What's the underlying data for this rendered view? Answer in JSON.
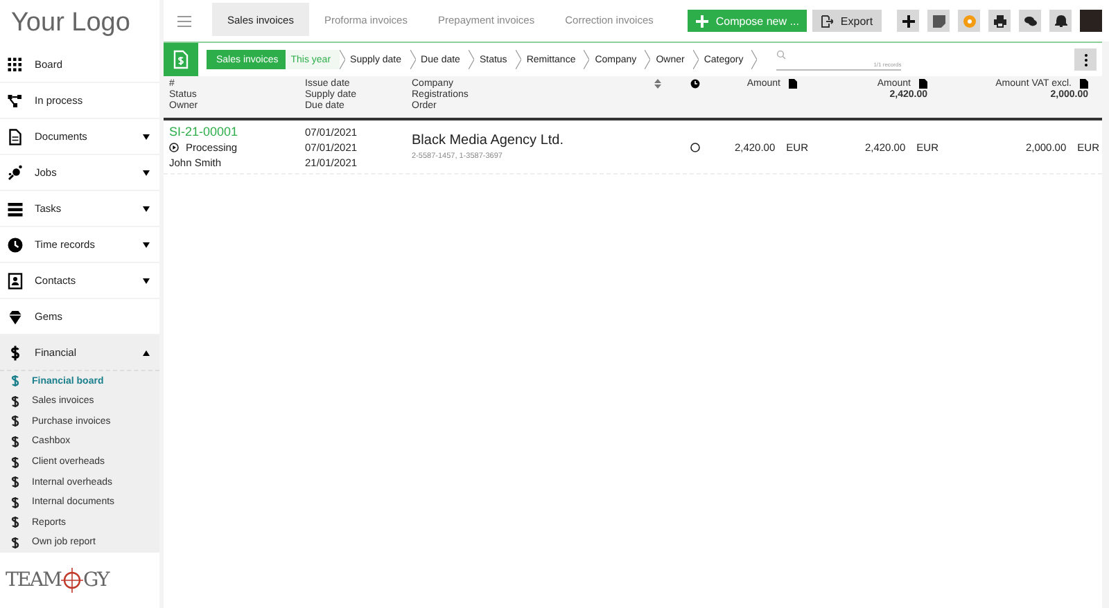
{
  "logo": {
    "text": "Your Logo"
  },
  "sidebar": {
    "items": [
      {
        "label": "Board",
        "kind": "link",
        "expanded": false
      },
      {
        "label": "In process",
        "kind": "link",
        "expanded": false
      },
      {
        "label": "Documents",
        "kind": "menu",
        "expanded": false
      },
      {
        "label": "Jobs",
        "kind": "menu",
        "expanded": false
      },
      {
        "label": "Tasks",
        "kind": "menu",
        "expanded": false
      },
      {
        "label": "Time records",
        "kind": "menu",
        "expanded": false
      },
      {
        "label": "Contacts",
        "kind": "menu",
        "expanded": false
      },
      {
        "label": "Gems",
        "kind": "link",
        "expanded": false
      },
      {
        "label": "Financial",
        "kind": "menu",
        "expanded": true,
        "children": [
          {
            "label": "Financial board",
            "selected": true
          },
          {
            "label": "Sales invoices",
            "selected": false
          },
          {
            "label": "Purchase invoices",
            "selected": false
          },
          {
            "label": "Cashbox",
            "selected": false
          },
          {
            "label": "Client overheads",
            "selected": false
          },
          {
            "label": "Internal overheads",
            "selected": false
          },
          {
            "label": "Internal documents",
            "selected": false
          },
          {
            "label": "Reports",
            "selected": false
          },
          {
            "label": "Own job report",
            "selected": false
          }
        ]
      }
    ]
  },
  "brand": {
    "left": "TEAM",
    "right": "GY"
  },
  "tabs": [
    {
      "label": "Sales invoices",
      "selected": true
    },
    {
      "label": "Proforma invoices",
      "selected": false
    },
    {
      "label": "Prepayment invoices",
      "selected": false
    },
    {
      "label": "Correction invoices",
      "selected": false
    }
  ],
  "actions": [
    {
      "label": "Compose new ...",
      "kind": "primary"
    },
    {
      "label": "Export",
      "kind": "secondary"
    }
  ],
  "filters": [
    {
      "label": "Sales invoices",
      "kind": "primary"
    },
    {
      "label": "This year",
      "kind": "active"
    },
    {
      "label": "Supply date",
      "kind": "plain"
    },
    {
      "label": "Due date",
      "kind": "plain"
    },
    {
      "label": "Status",
      "kind": "plain"
    },
    {
      "label": "Remittance",
      "kind": "plain"
    },
    {
      "label": "Company",
      "kind": "plain"
    },
    {
      "label": "Owner",
      "kind": "plain"
    },
    {
      "label": "Category",
      "kind": "plain"
    }
  ],
  "search": {
    "records": "1/1 records"
  },
  "table": {
    "columns": [
      {
        "lines": [
          "#",
          "Status",
          "Owner"
        ]
      },
      {
        "lines": [
          "Issue date",
          "Supply date",
          "Due date"
        ]
      },
      {
        "lines": [
          "Company",
          "Registrations",
          "Order"
        ]
      }
    ],
    "amount_columns": [
      {
        "label": "Amount"
      },
      {
        "label": "Amount",
        "total": "2,420.00"
      },
      {
        "label": "Amount VAT excl.",
        "total": "2,000.00"
      }
    ],
    "rows": [
      {
        "number": "SI-21-00001",
        "status": "Processing",
        "owner": "John Smith",
        "dates": [
          "07/01/2021",
          "07/01/2021",
          "21/01/2021"
        ],
        "company": "Black Media Agency Ltd.",
        "registrations": "2-5587-1457, 1-3587-3697",
        "amounts": [
          {
            "value": "2,420.00",
            "currency": "EUR"
          },
          {
            "value": "2,420.00",
            "currency": "EUR"
          },
          {
            "value": "2,000.00",
            "currency": "EUR"
          }
        ]
      }
    ]
  }
}
